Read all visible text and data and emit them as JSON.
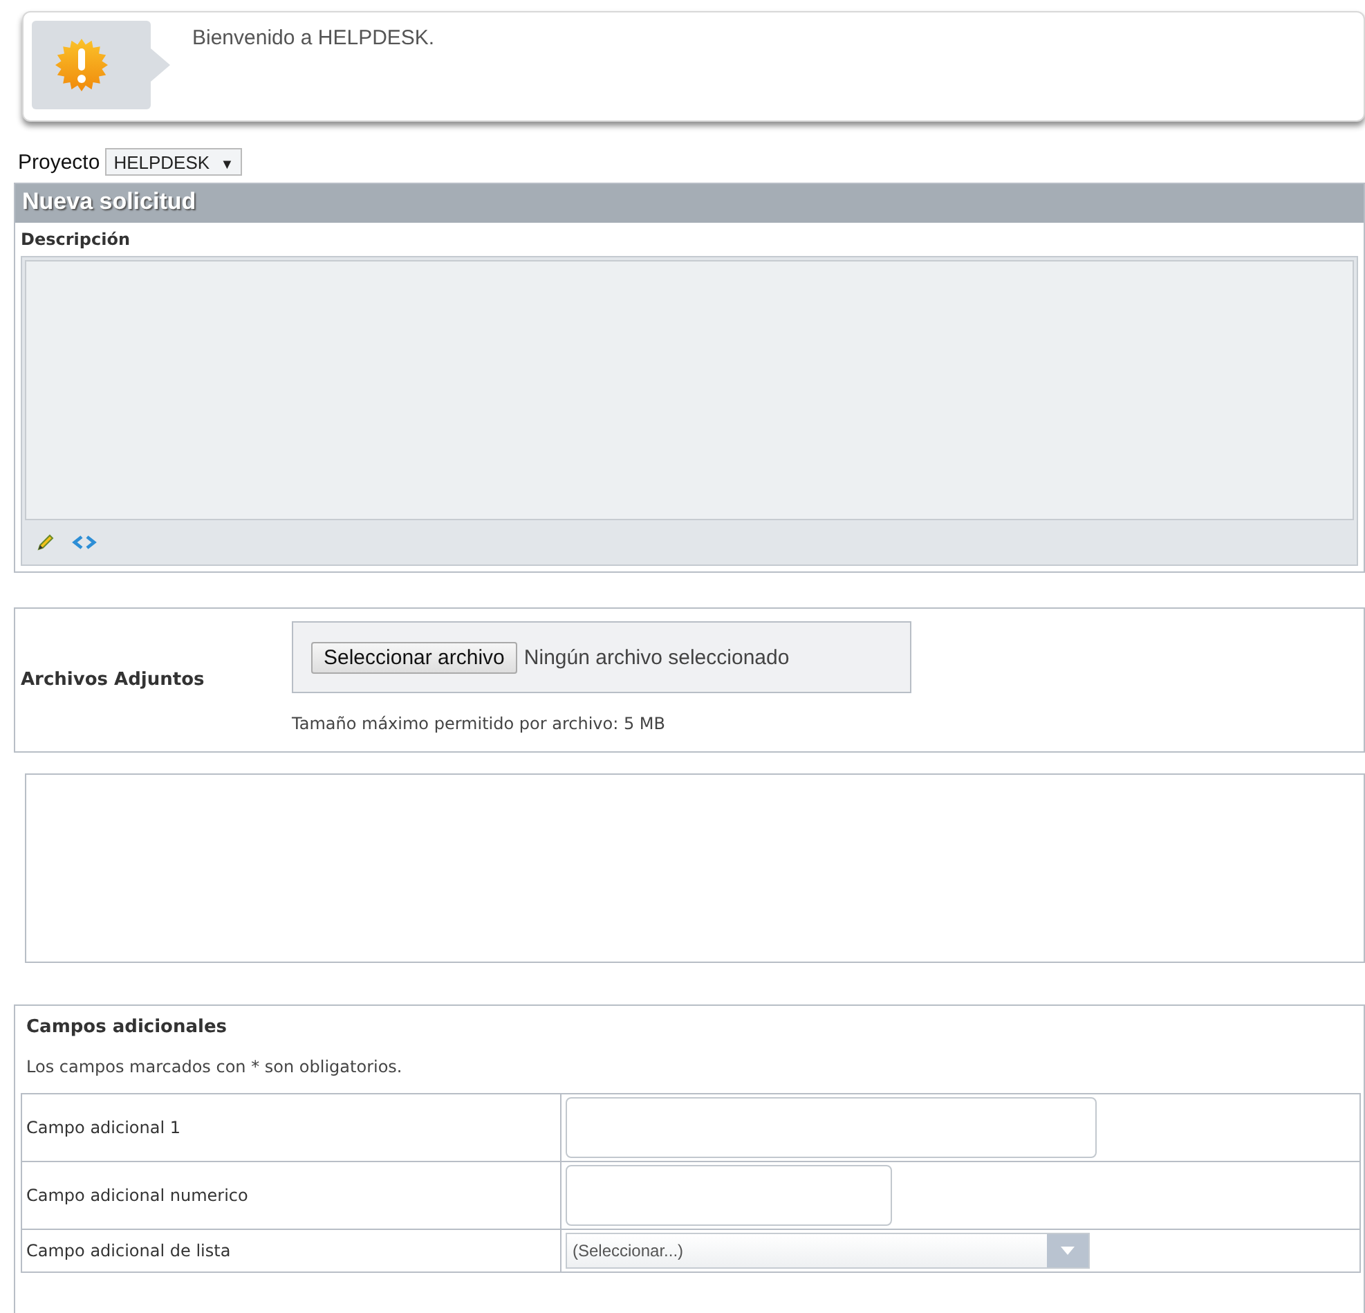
{
  "notice": {
    "message": "Bienvenido a HELPDESK."
  },
  "project": {
    "label": "Proyecto",
    "value": "HELPDESK",
    "arrow": "▼"
  },
  "form": {
    "title": "Nueva solicitud",
    "description_label": "Descripción"
  },
  "attachments": {
    "label": "Archivos Adjuntos",
    "button": "Seleccionar archivo",
    "status": "Ningún archivo seleccionado",
    "hint": "Tamaño máximo permitido por archivo: 5 MB"
  },
  "additional": {
    "title": "Campos adicionales",
    "note": "Los campos marcados con * son obligatorios.",
    "fields": [
      {
        "label": "Campo adicional 1",
        "kind": "text"
      },
      {
        "label": "Campo adicional numerico",
        "kind": "number"
      },
      {
        "label": "Campo adicional de lista",
        "kind": "select",
        "placeholder": "(Seleccionar...)"
      }
    ]
  }
}
